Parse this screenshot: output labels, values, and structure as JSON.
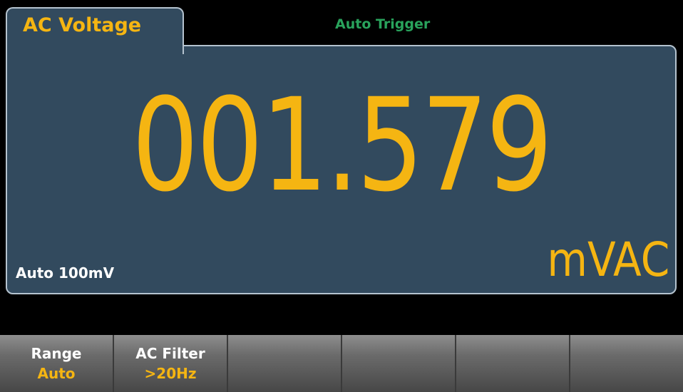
{
  "header": {
    "mode_label": "AC Voltage",
    "trigger_label": "Auto Trigger"
  },
  "display": {
    "reading": "001.579",
    "unit": "mVAC",
    "range_info": "Auto 100mV"
  },
  "softkeys": [
    {
      "title": "Range",
      "value": "Auto"
    },
    {
      "title": "AC Filter",
      "value": ">20Hz"
    },
    {
      "title": "",
      "value": ""
    },
    {
      "title": "",
      "value": ""
    },
    {
      "title": "",
      "value": ""
    },
    {
      "title": "",
      "value": ""
    }
  ],
  "colors": {
    "display_background": "#324a5e",
    "reading": "#f5b512",
    "trigger": "#29a35c",
    "border": "#b5c3cf"
  }
}
